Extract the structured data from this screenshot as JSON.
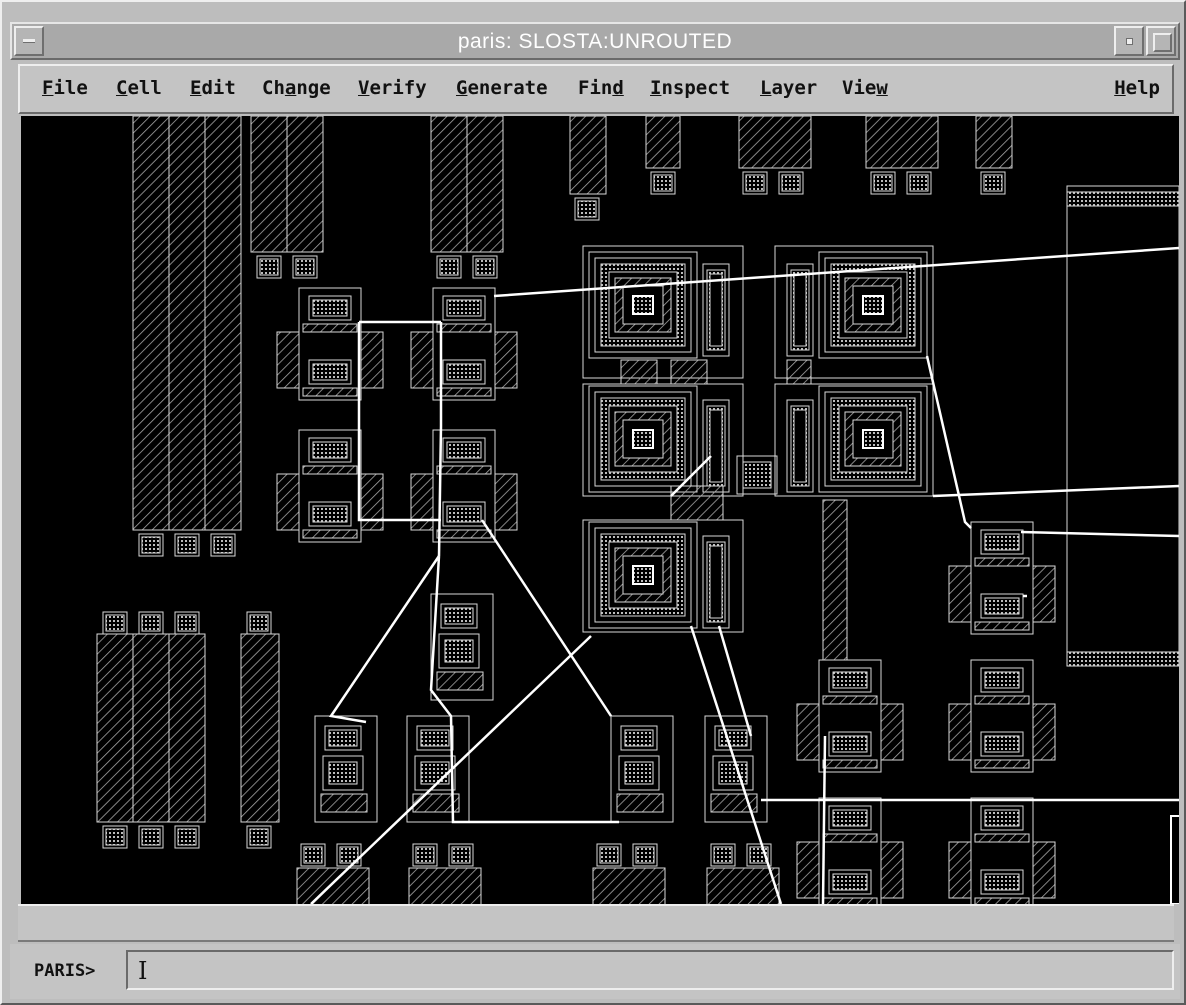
{
  "window": {
    "title": "paris: SLOSTA:UNROUTED"
  },
  "menubar": {
    "items": [
      {
        "label": "File",
        "mnemonic_index": 0
      },
      {
        "label": "Cell",
        "mnemonic_index": 0
      },
      {
        "label": "Edit",
        "mnemonic_index": 0
      },
      {
        "label": "Change",
        "mnemonic_index": 2
      },
      {
        "label": "Verify",
        "mnemonic_index": 0
      },
      {
        "label": "Generate",
        "mnemonic_index": 0
      },
      {
        "label": "Find",
        "mnemonic_index": 3
      },
      {
        "label": "Inspect",
        "mnemonic_index": 0
      },
      {
        "label": "Layer",
        "mnemonic_index": 0
      },
      {
        "label": "View",
        "mnemonic_index": 3
      },
      {
        "label": "Help",
        "mnemonic_index": 0
      }
    ]
  },
  "canvas": {
    "background_color": "#000000",
    "geometry_color": "#d8d8d8",
    "wire_color": "#ffffff",
    "hatch_color": "#9a9a9a"
  },
  "status": {
    "text": ""
  },
  "command": {
    "prompt": "PARIS>",
    "value": ""
  },
  "colors": {
    "chrome": "#c4c4c4",
    "titlebar": "#a9a9a9",
    "title_text": "#ffffff"
  }
}
